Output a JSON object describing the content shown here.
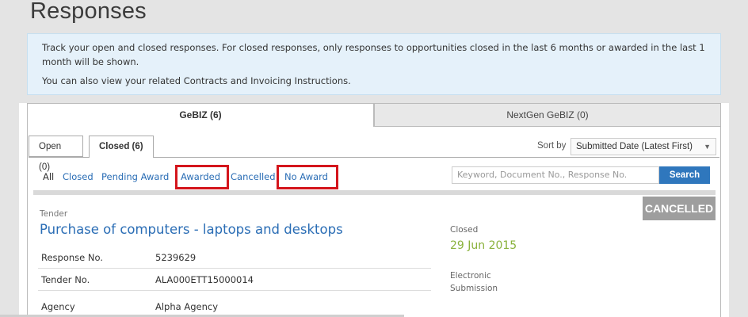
{
  "page": {
    "title": "Responses",
    "info": [
      "Track your open and closed responses. For closed responses, only responses to opportunities closed in the last 6 months or awarded in the last 1 month will be shown.",
      "You can also view your related Contracts and Invoicing Instructions."
    ]
  },
  "main_tabs": [
    {
      "label": "GeBIZ (6)",
      "active": true
    },
    {
      "label": "NextGen GeBIZ (0)",
      "active": false
    }
  ],
  "sub_tabs": [
    {
      "label": "Open (0)",
      "active": false
    },
    {
      "label": "Closed (6)",
      "active": true
    }
  ],
  "sort": {
    "label": "Sort by",
    "value": "Submitted Date (Latest First)"
  },
  "filters": {
    "all": "All",
    "closed": "Closed",
    "pending_award": "Pending Award",
    "awarded": "Awarded",
    "cancelled": "Cancelled",
    "no_award": "No Award"
  },
  "search": {
    "placeholder": "Keyword, Document No., Response No.",
    "button": "Search"
  },
  "record": {
    "badge": "CANCELLED",
    "type": "Tender",
    "title": "Purchase of computers - laptops and desktops",
    "fields": [
      {
        "label": "Response No.",
        "value": "5239629"
      },
      {
        "label": "Tender No.",
        "value": "ALA000ETT15000014"
      },
      {
        "label": "Agency",
        "value": "Alpha Agency"
      }
    ],
    "status_label": "Closed",
    "status_date": "29 Jun 2015",
    "submission_label": "Electronic Submission"
  },
  "colors": {
    "link": "#2a6db5",
    "highlight": "#d4151c",
    "date": "#8ab23c",
    "badge": "#9e9e9e",
    "search_button": "#2f77bd"
  }
}
